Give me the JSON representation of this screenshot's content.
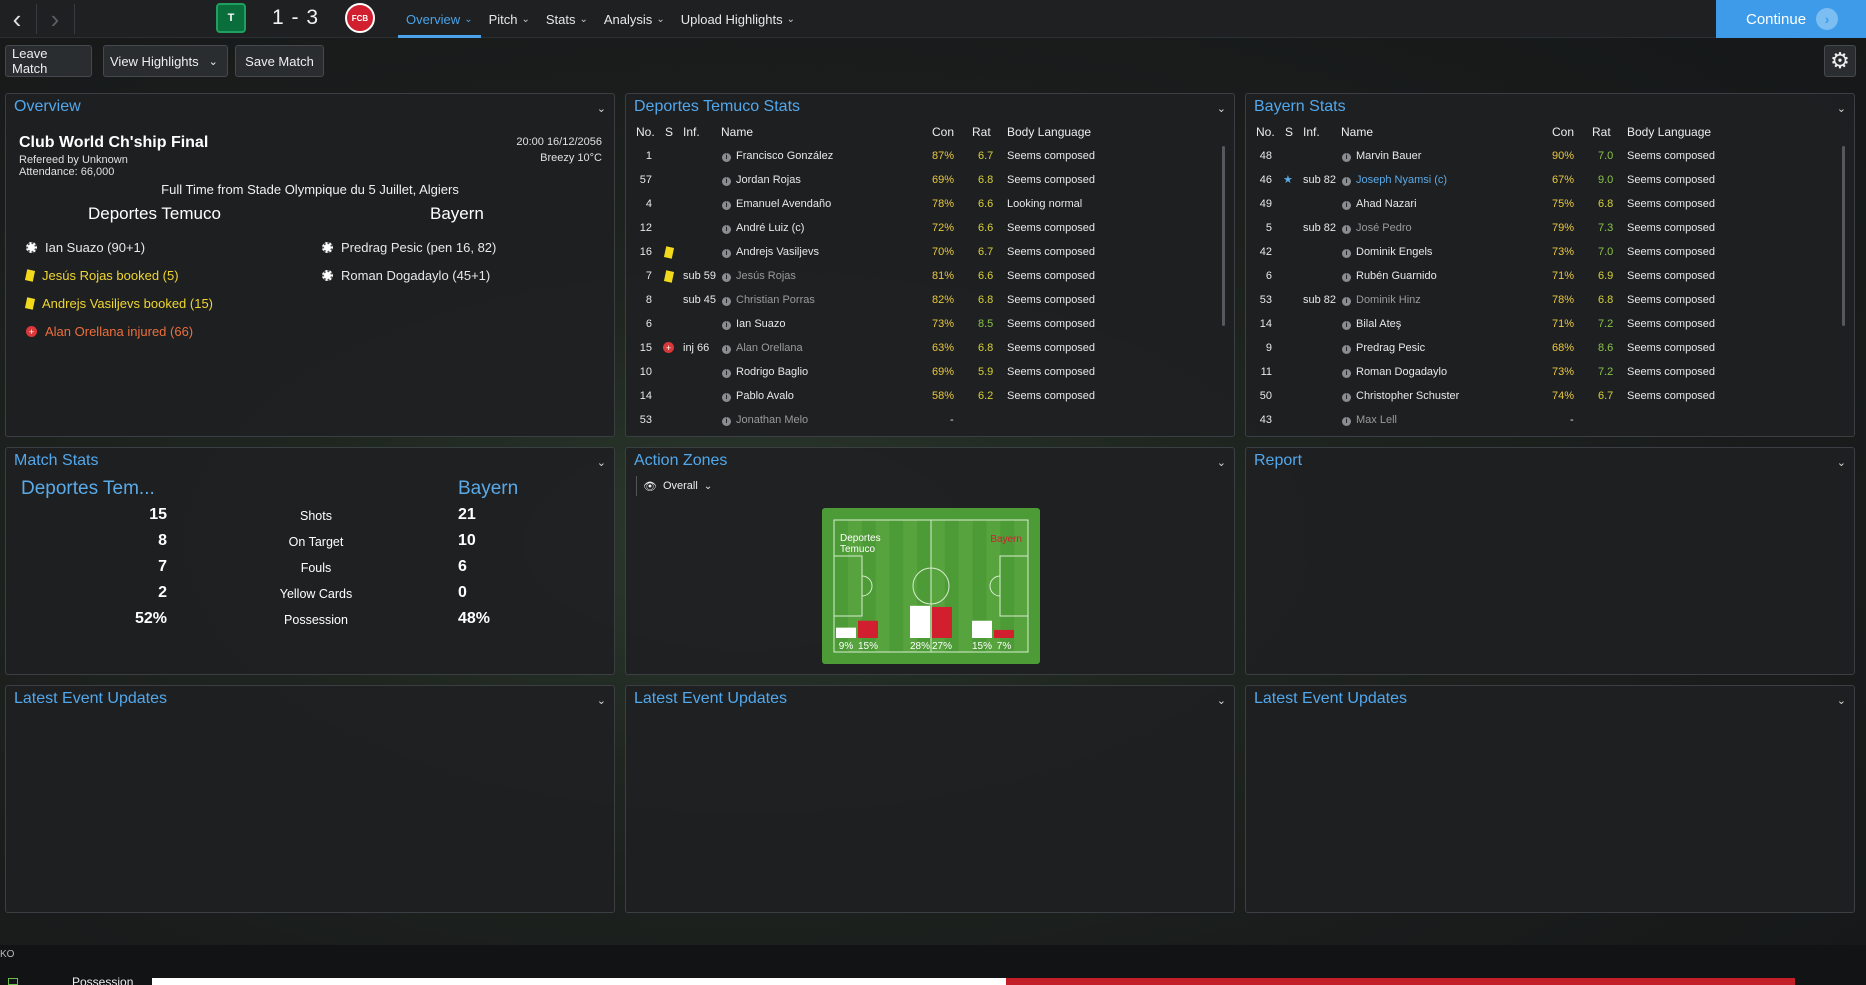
{
  "topbar": {
    "back_icon": "chevron-left-icon",
    "forward_icon": "chevron-right-icon",
    "score": "1 - 3",
    "home_crest": "T",
    "away_crest": "FCB",
    "menu": [
      {
        "label": "Overview",
        "active": true
      },
      {
        "label": "Pitch",
        "active": false
      },
      {
        "label": "Stats",
        "active": false
      },
      {
        "label": "Analysis",
        "active": false
      },
      {
        "label": "Upload Highlights",
        "active": false
      }
    ],
    "continue_label": "Continue"
  },
  "toolbar": {
    "leave_label": "Leave Match",
    "highlights_label": "View Highlights",
    "save_label": "Save Match"
  },
  "overview": {
    "title": "Overview",
    "competition": "Club World Ch'ship Final",
    "referee": "Refereed by Unknown",
    "attendance": "Attendance: 66,000",
    "datetime": "20:00 16/12/2056",
    "weather": "Breezy 10°C",
    "venue": "Full Time from Stade Olympique du 5 Juillet, Algiers",
    "home_team": "Deportes Temuco",
    "away_team": "Bayern",
    "home_events": [
      {
        "type": "goal",
        "text": "Ian Suazo (90+1)"
      },
      {
        "type": "yellow",
        "text": "Jesús Rojas booked (5)"
      },
      {
        "type": "yellow",
        "text": "Andrejs Vasiljevs booked (15)"
      },
      {
        "type": "injury",
        "text": "Alan Orellana injured (66)"
      }
    ],
    "away_events": [
      {
        "type": "goal",
        "text": "Predrag Pesic (pen 16, 82)"
      },
      {
        "type": "goal",
        "text": "Roman Dogadaylo (45+1)"
      }
    ]
  },
  "headers": {
    "no": "No.",
    "s": "S",
    "inf": "Inf.",
    "name": "Name",
    "con": "Con",
    "rat": "Rat",
    "body": "Body Language"
  },
  "home_stats": {
    "title": "Deportes Temuco Stats",
    "rows": [
      {
        "no": "1",
        "s": "",
        "inf": "",
        "name": "Francisco González",
        "con": "87%",
        "rat": "6.7",
        "body": "Seems composed",
        "dim": false
      },
      {
        "no": "57",
        "s": "",
        "inf": "",
        "name": "Jordan Rojas",
        "con": "69%",
        "rat": "6.8",
        "body": "Seems composed",
        "dim": false
      },
      {
        "no": "4",
        "s": "",
        "inf": "",
        "name": "Emanuel Avendaño",
        "con": "78%",
        "rat": "6.6",
        "body": "Looking normal",
        "dim": false
      },
      {
        "no": "12",
        "s": "",
        "inf": "",
        "name": "André Luiz (c)",
        "con": "72%",
        "rat": "6.6",
        "body": "Seems composed",
        "dim": false
      },
      {
        "no": "16",
        "s": "yellow",
        "inf": "",
        "name": "Andrejs Vasiljevs",
        "con": "70%",
        "rat": "6.7",
        "body": "Seems composed",
        "dim": false
      },
      {
        "no": "7",
        "s": "yellow",
        "inf": "sub 59",
        "name": "Jesús Rojas",
        "con": "81%",
        "rat": "6.6",
        "body": "Seems composed",
        "dim": true
      },
      {
        "no": "8",
        "s": "",
        "inf": "sub 45",
        "name": "Christian Porras",
        "con": "82%",
        "rat": "6.8",
        "body": "Seems composed",
        "dim": true
      },
      {
        "no": "6",
        "s": "",
        "inf": "",
        "name": "Ian Suazo",
        "con": "73%",
        "rat": "8.5",
        "body": "Seems composed",
        "dim": false
      },
      {
        "no": "15",
        "s": "injury",
        "inf": "inj 66",
        "name": "Alan Orellana",
        "con": "63%",
        "rat": "6.8",
        "body": "Seems composed",
        "dim": true
      },
      {
        "no": "10",
        "s": "",
        "inf": "",
        "name": "Rodrigo Baglio",
        "con": "69%",
        "rat": "5.9",
        "body": "Seems composed",
        "dim": false
      },
      {
        "no": "14",
        "s": "",
        "inf": "",
        "name": "Pablo Avalo",
        "con": "58%",
        "rat": "6.2",
        "body": "Seems composed",
        "dim": false
      },
      {
        "no": "53",
        "s": "",
        "inf": "",
        "name": "Jonathan Melo",
        "con": "-",
        "rat": "",
        "body": "",
        "dim": true
      }
    ]
  },
  "away_stats": {
    "title": "Bayern Stats",
    "rows": [
      {
        "no": "48",
        "s": "",
        "inf": "",
        "name": "Marvin Bauer",
        "con": "90%",
        "rat": "7.0",
        "body": "Seems composed",
        "dim": false
      },
      {
        "no": "46",
        "s": "star",
        "inf": "sub 82",
        "name": "Joseph Nyamsi (c)",
        "con": "67%",
        "rat": "9.0",
        "body": "Seems composed",
        "dim": false,
        "blue": true
      },
      {
        "no": "49",
        "s": "",
        "inf": "",
        "name": "Ahad Nazari",
        "con": "75%",
        "rat": "6.8",
        "body": "Seems composed",
        "dim": false
      },
      {
        "no": "5",
        "s": "",
        "inf": "sub 82",
        "name": "José Pedro",
        "con": "79%",
        "rat": "7.3",
        "body": "Seems composed",
        "dim": true
      },
      {
        "no": "42",
        "s": "",
        "inf": "",
        "name": "Dominik Engels",
        "con": "73%",
        "rat": "7.0",
        "body": "Seems composed",
        "dim": false
      },
      {
        "no": "6",
        "s": "",
        "inf": "",
        "name": "Rubén Guarnido",
        "con": "71%",
        "rat": "6.9",
        "body": "Seems composed",
        "dim": false
      },
      {
        "no": "53",
        "s": "",
        "inf": "sub 82",
        "name": "Dominik Hinz",
        "con": "78%",
        "rat": "6.8",
        "body": "Seems composed",
        "dim": true
      },
      {
        "no": "14",
        "s": "",
        "inf": "",
        "name": "Bilal Ateş",
        "con": "71%",
        "rat": "7.2",
        "body": "Seems composed",
        "dim": false
      },
      {
        "no": "9",
        "s": "",
        "inf": "",
        "name": "Predrag Pesic",
        "con": "68%",
        "rat": "8.6",
        "body": "Seems composed",
        "dim": false
      },
      {
        "no": "11",
        "s": "",
        "inf": "",
        "name": "Roman Dogadaylo",
        "con": "73%",
        "rat": "7.2",
        "body": "Seems composed",
        "dim": false
      },
      {
        "no": "50",
        "s": "",
        "inf": "",
        "name": "Christopher Schuster",
        "con": "74%",
        "rat": "6.7",
        "body": "Seems composed",
        "dim": false
      },
      {
        "no": "43",
        "s": "",
        "inf": "",
        "name": "Max Lell",
        "con": "-",
        "rat": "",
        "body": "",
        "dim": true
      }
    ]
  },
  "match_stats": {
    "title": "Match Stats",
    "home": "Deportes Tem...",
    "away": "Bayern",
    "rows": [
      {
        "home": "15",
        "label": "Shots",
        "away": "21"
      },
      {
        "home": "8",
        "label": "On Target",
        "away": "10"
      },
      {
        "home": "7",
        "label": "Fouls",
        "away": "6"
      },
      {
        "home": "2",
        "label": "Yellow Cards",
        "away": "0"
      },
      {
        "home": "52%",
        "label": "Possession",
        "away": "48%"
      }
    ]
  },
  "action_zones": {
    "title": "Action Zones",
    "filter": "Overall",
    "home_label": "Deportes Temuco",
    "away_label": "Bayern",
    "zones": [
      {
        "home": 9,
        "away": 15,
        "home_label": "9%",
        "away_label": "15%"
      },
      {
        "home": 28,
        "away": 27,
        "home_label": "28%",
        "away_label": "27%"
      },
      {
        "home": 15,
        "away": 7,
        "home_label": "15%",
        "away_label": "7%"
      }
    ]
  },
  "report": {
    "title": "Report"
  },
  "latest": {
    "title": "Latest Event Updates"
  },
  "bottom": {
    "ko": "KO",
    "possession_label": "Possession",
    "home_possession": 52
  },
  "colors": {
    "accent": "#4aa3e8",
    "home": "#ffffff",
    "away": "#d11f2f",
    "pitch": "#4d9b36"
  }
}
